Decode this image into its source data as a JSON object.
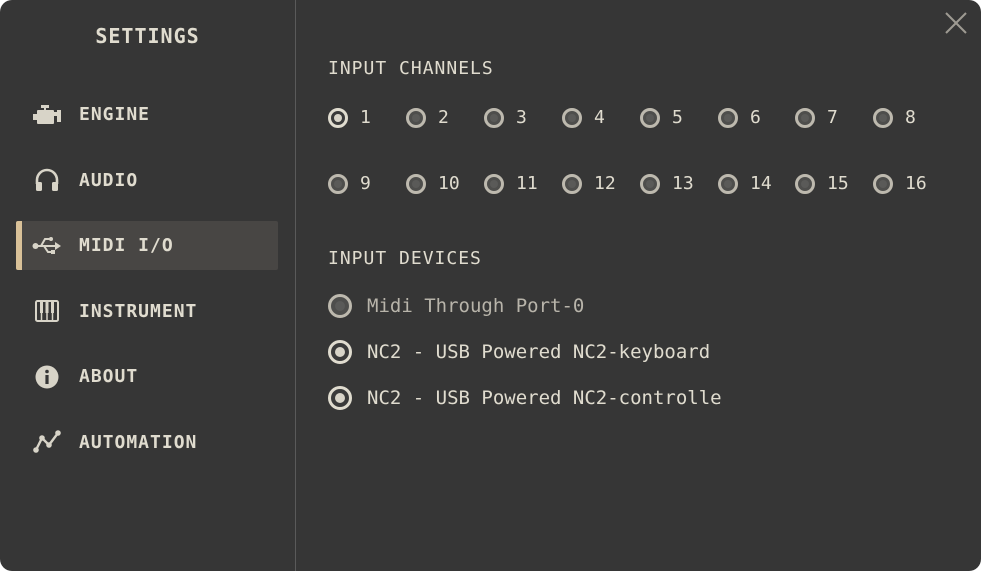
{
  "sidebar": {
    "title": "SETTINGS",
    "items": [
      {
        "label": "ENGINE",
        "icon": "engine-icon",
        "active": false
      },
      {
        "label": "AUDIO",
        "icon": "headphones-icon",
        "active": false
      },
      {
        "label": "MIDI I/O",
        "icon": "usb-icon",
        "active": true
      },
      {
        "label": "INSTRUMENT",
        "icon": "piano-keys-icon",
        "active": false
      },
      {
        "label": "ABOUT",
        "icon": "info-icon",
        "active": false
      },
      {
        "label": "AUTOMATION",
        "icon": "automation-graph-icon",
        "active": false
      }
    ]
  },
  "close": {
    "icon": "close-icon"
  },
  "channels": {
    "title": "INPUT CHANNELS",
    "items": [
      {
        "label": "1",
        "checked": true
      },
      {
        "label": "2",
        "checked": false
      },
      {
        "label": "3",
        "checked": false
      },
      {
        "label": "4",
        "checked": false
      },
      {
        "label": "5",
        "checked": false
      },
      {
        "label": "6",
        "checked": false
      },
      {
        "label": "7",
        "checked": false
      },
      {
        "label": "8",
        "checked": false
      },
      {
        "label": "9",
        "checked": false
      },
      {
        "label": "10",
        "checked": false
      },
      {
        "label": "11",
        "checked": false
      },
      {
        "label": "12",
        "checked": false
      },
      {
        "label": "13",
        "checked": false
      },
      {
        "label": "14",
        "checked": false
      },
      {
        "label": "15",
        "checked": false
      },
      {
        "label": "16",
        "checked": false
      }
    ]
  },
  "devices": {
    "title": "INPUT DEVICES",
    "items": [
      {
        "label": "Midi Through Port-0",
        "checked": false
      },
      {
        "label": "NC2 - USB Powered NC2-keyboard",
        "checked": true
      },
      {
        "label": "NC2 - USB Powered NC2-controlle",
        "checked": true
      }
    ]
  },
  "colors": {
    "background": "#363636",
    "text": "#e0dccf",
    "accent": "#d9c198",
    "active_item": "#484644"
  }
}
